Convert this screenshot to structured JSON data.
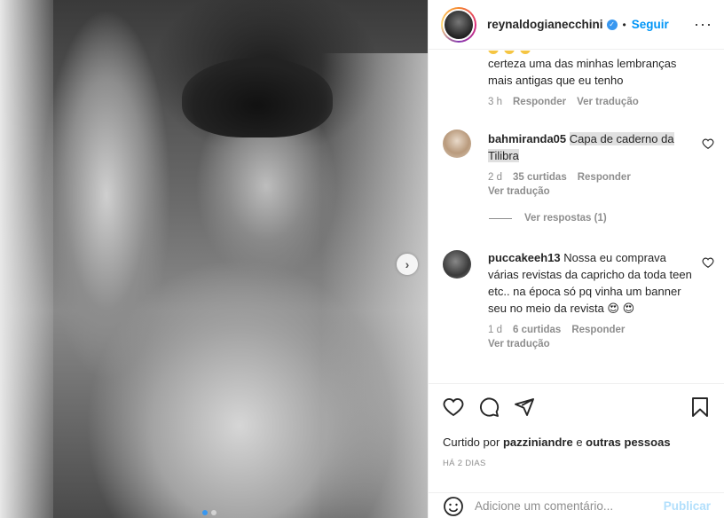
{
  "post": {
    "username": "reynaldogianecchini",
    "separator": "•",
    "follow_label": "Seguir",
    "more_label": "···",
    "carousel_next": "›"
  },
  "comments": [
    {
      "text": "certeza uma das minhas lembranças mais antigas que eu tenho",
      "time": "3 h",
      "reply_label": "Responder",
      "translate_label": "Ver tradução"
    },
    {
      "username": "bahmiranda05",
      "text": "Capa de caderno da Tilibra",
      "time": "2 d",
      "likes": "35 curtidas",
      "reply_label": "Responder",
      "translate_label": "Ver tradução",
      "view_replies": "Ver respostas (1)"
    },
    {
      "username": "puccakeeh13",
      "text": "Nossa eu comprava várias revistas da capricho da toda teen etc.. na época só pq vinha um banner seu no meio da revista 😍 😍",
      "time": "1 d",
      "likes": "6 curtidas",
      "reply_label": "Responder",
      "translate_label": "Ver tradução"
    }
  ],
  "actions": {
    "liked_prefix": "Curtido por",
    "liked_user": "pazziniandre",
    "liked_and": "e",
    "liked_others": "outras pessoas",
    "time_ago": "HÁ 2 DIAS",
    "comment_placeholder": "Adicione um comentário...",
    "publish_label": "Publicar"
  },
  "icons": {
    "like": "heart-icon",
    "comment": "comment-icon",
    "share": "share-icon",
    "save": "bookmark-icon",
    "emoji": "emoji-icon",
    "verified": "verified-badge-icon"
  },
  "colors": {
    "accent": "#0095f6",
    "publish_disabled": "#b2dffc",
    "muted": "#8e8e8e"
  }
}
